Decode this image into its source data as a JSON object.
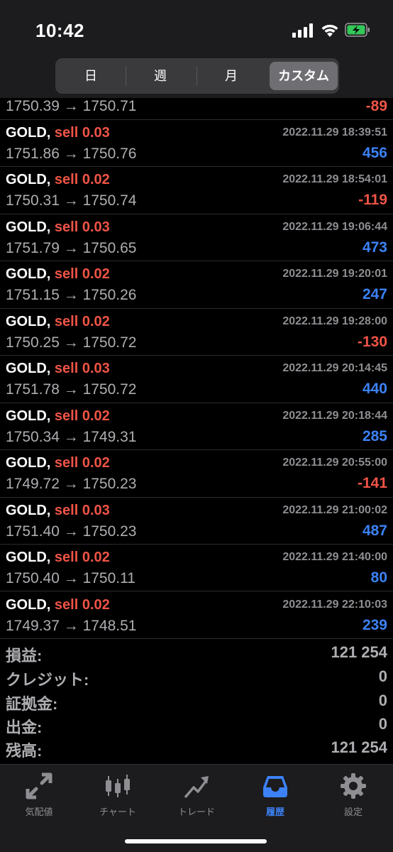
{
  "status": {
    "time": "10:42"
  },
  "segments": [
    {
      "label": "日",
      "active": false
    },
    {
      "label": "週",
      "active": false
    },
    {
      "label": "月",
      "active": false
    },
    {
      "label": "カスタム",
      "active": true
    }
  ],
  "partial_row": {
    "prices": "1750.39 → 1750.71",
    "pl": "-89"
  },
  "trades": [
    {
      "symbol": "GOLD,",
      "side": "sell 0.03",
      "datetime": "2022.11.29 18:39:51",
      "prices": "1751.86 → 1750.76",
      "pl": "456"
    },
    {
      "symbol": "GOLD,",
      "side": "sell 0.02",
      "datetime": "2022.11.29 18:54:01",
      "prices": "1750.31 → 1750.74",
      "pl": "-119"
    },
    {
      "symbol": "GOLD,",
      "side": "sell 0.03",
      "datetime": "2022.11.29 19:06:44",
      "prices": "1751.79 → 1750.65",
      "pl": "473"
    },
    {
      "symbol": "GOLD,",
      "side": "sell 0.02",
      "datetime": "2022.11.29 19:20:01",
      "prices": "1751.15 → 1750.26",
      "pl": "247"
    },
    {
      "symbol": "GOLD,",
      "side": "sell 0.02",
      "datetime": "2022.11.29 19:28:00",
      "prices": "1750.25 → 1750.72",
      "pl": "-130"
    },
    {
      "symbol": "GOLD,",
      "side": "sell 0.03",
      "datetime": "2022.11.29 20:14:45",
      "prices": "1751.78 → 1750.72",
      "pl": "440"
    },
    {
      "symbol": "GOLD,",
      "side": "sell 0.02",
      "datetime": "2022.11.29 20:18:44",
      "prices": "1750.34 → 1749.31",
      "pl": "285"
    },
    {
      "symbol": "GOLD,",
      "side": "sell 0.02",
      "datetime": "2022.11.29 20:55:00",
      "prices": "1749.72 → 1750.23",
      "pl": "-141"
    },
    {
      "symbol": "GOLD,",
      "side": "sell 0.03",
      "datetime": "2022.11.29 21:00:02",
      "prices": "1751.40 → 1750.23",
      "pl": "487"
    },
    {
      "symbol": "GOLD,",
      "side": "sell 0.02",
      "datetime": "2022.11.29 21:40:00",
      "prices": "1750.40 → 1750.11",
      "pl": "80"
    },
    {
      "symbol": "GOLD,",
      "side": "sell 0.02",
      "datetime": "2022.11.29 22:10:03",
      "prices": "1749.37 → 1748.51",
      "pl": "239"
    }
  ],
  "summary": [
    {
      "label": "損益:",
      "value": "121 254"
    },
    {
      "label": "クレジット:",
      "value": "0"
    },
    {
      "label": "証拠金:",
      "value": "0"
    },
    {
      "label": "出金:",
      "value": "0"
    },
    {
      "label": "残高:",
      "value": "121 254"
    }
  ],
  "tabs": [
    {
      "label": "気配値",
      "icon": "quotes-icon",
      "active": false
    },
    {
      "label": "チャート",
      "icon": "chart-icon",
      "active": false
    },
    {
      "label": "トレード",
      "icon": "trade-icon",
      "active": false
    },
    {
      "label": "履歴",
      "icon": "history-icon",
      "active": true
    },
    {
      "label": "設定",
      "icon": "settings-icon",
      "active": false
    }
  ],
  "colors": {
    "positive": "#3c82f6",
    "negative": "#ef5446",
    "sell": "#ef5446",
    "active_tab": "#3c82f6"
  }
}
